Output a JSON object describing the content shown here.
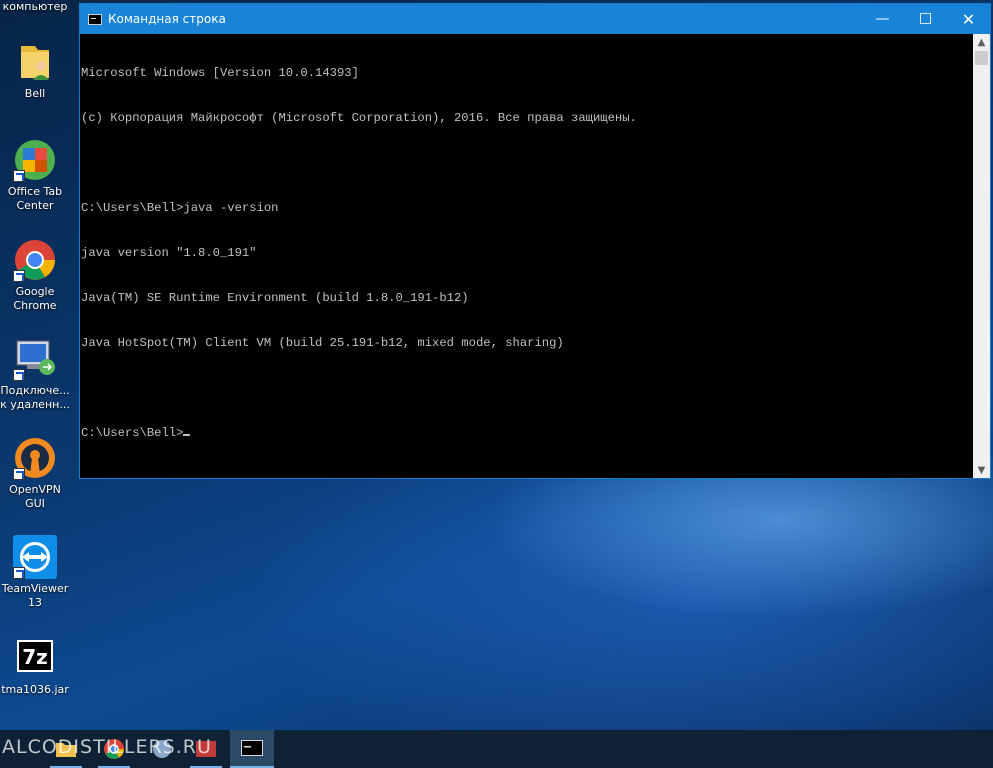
{
  "desktop": {
    "top_label": "компьютер",
    "icons": [
      {
        "label": "Bell",
        "icon": "user-folder-icon"
      },
      {
        "label": "Office Tab\nCenter",
        "icon": "office-tab-icon"
      },
      {
        "label": "Google\nChrome",
        "icon": "chrome-icon"
      },
      {
        "label": "Подключе...\nк удаленн...",
        "icon": "remote-desktop-icon"
      },
      {
        "label": "OpenVPN\nGUI",
        "icon": "openvpn-icon"
      },
      {
        "label": "TeamViewer\n13",
        "icon": "teamviewer-icon"
      },
      {
        "label": "tma1036.jar",
        "icon": "7zip-icon"
      }
    ]
  },
  "window": {
    "title": "Командная строка",
    "minimize": "—",
    "maximize": "☐",
    "close": "✕",
    "console_lines": [
      "Microsoft Windows [Version 10.0.14393]",
      "(c) Корпорация Майкрософт (Microsoft Corporation), 2016. Все права защищены.",
      "",
      "C:\\Users\\Bell>java -version",
      "java version \"1.8.0_191\"",
      "Java(TM) SE Runtime Environment (build 1.8.0_191-b12)",
      "Java HotSpot(TM) Client VM (build 25.191-b12, mixed mode, sharing)",
      "",
      "C:\\Users\\Bell>"
    ]
  },
  "taskbar": {
    "watermark": "ALCODISTILLERS.RU"
  },
  "colors": {
    "titlebar": "#1883d7",
    "console_bg": "#000000",
    "console_text": "#c0c0c0",
    "taskbar": "#0f2235"
  }
}
